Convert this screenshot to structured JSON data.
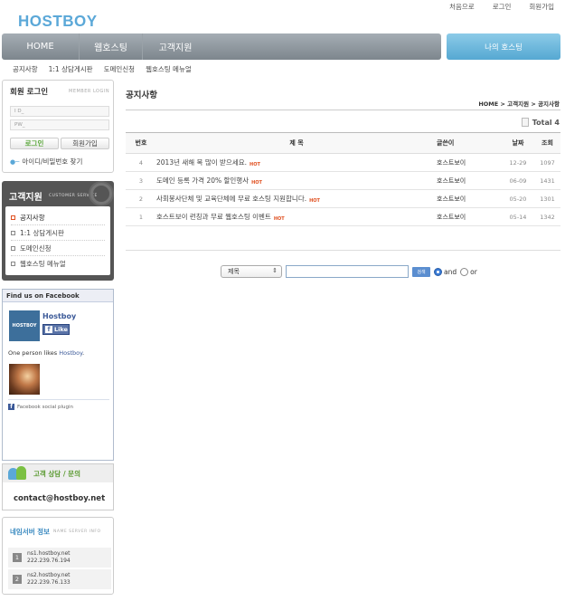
{
  "header": {
    "logo": "HOSTBOY",
    "top_links": [
      "처음으로",
      "로그인",
      "회원가입"
    ]
  },
  "nav": {
    "home": "HOME",
    "hosting": "웹호스팅",
    "support": "고객지원",
    "my_hosting": "나의 호스팅"
  },
  "subnav": [
    "공지사항",
    "1:1 상담게시판",
    "도메인신청",
    "웹호스팅 메뉴얼"
  ],
  "login": {
    "title": "회원 로그인",
    "title_en": "MEMBER LOGIN",
    "id_placeholder": "I D_",
    "pw_placeholder": "PW_",
    "login_button": "로그인",
    "join_button": "회원가입",
    "find_link": "아이디/비밀번호 찾기"
  },
  "customer_service": {
    "title": "고객지원",
    "title_en": "CUSTOMER SERVICE",
    "items": [
      "공지사항",
      "1:1 상담게시판",
      "도메인신청",
      "웹호스팅 메뉴얼"
    ]
  },
  "facebook": {
    "title": "Find us on Facebook",
    "logo_text": "HOSTBOY",
    "page_name": "Hostboy",
    "like_button": "Like",
    "count_prefix": "One person likes ",
    "count_link": "Hostboy",
    "count_suffix": ".",
    "footer": "Facebook social plugin"
  },
  "consult": {
    "title": "고객 상담 / 문의",
    "email": "contact@hostboy.net"
  },
  "name_server": {
    "title": "네임서버 정보",
    "title_en": "NAME SERVER INFO",
    "servers": [
      {
        "num": "1",
        "host": "ns1.hostboy.net",
        "ip": "222.239.76.194"
      },
      {
        "num": "2",
        "host": "ns2.hostboy.net",
        "ip": "222.239.76.133"
      }
    ]
  },
  "main": {
    "title": "공지사항",
    "breadcrumb": "HOME > 고객지원 > 공지사항",
    "total": "Total 4"
  },
  "board": {
    "headers": {
      "num": "번호",
      "title": "제 목",
      "author": "글쓴이",
      "date": "날짜",
      "views": "조회"
    },
    "hot_label": "HOT",
    "rows": [
      {
        "num": "4",
        "title": "2013년 새해 복 많이 받으세요.",
        "author": "호스트보이",
        "date": "12-29",
        "views": "1097"
      },
      {
        "num": "3",
        "title": "도메인 등록 가격 20% 할인행사",
        "author": "호스트보이",
        "date": "06-09",
        "views": "1431"
      },
      {
        "num": "2",
        "title": "사회봉사단체 및 교육단체에 무료 호스팅 지원합니다.",
        "author": "호스트보이",
        "date": "05-20",
        "views": "1301"
      },
      {
        "num": "1",
        "title": "호스트보이 런칭과 무료 웹호스팅 이벤트",
        "author": "호스트보이",
        "date": "05-14",
        "views": "1342"
      }
    ]
  },
  "search": {
    "field_select": "제목",
    "search_button": "검색",
    "and_label": "and",
    "or_label": "or"
  }
}
